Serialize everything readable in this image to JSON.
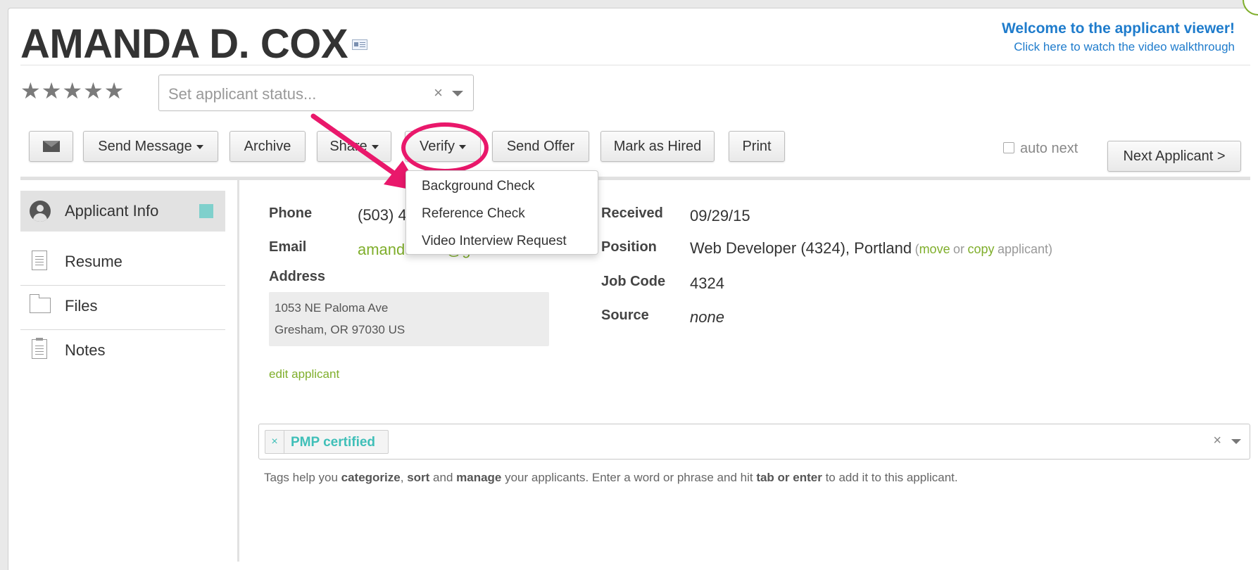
{
  "applicant": {
    "name": "AMANDA D. COX",
    "rating_stars": "★★★★★"
  },
  "welcome": {
    "title": "Welcome to the applicant viewer!",
    "link": "Click here to watch the video walkthrough"
  },
  "status": {
    "placeholder": "Set applicant status...",
    "clear": "×"
  },
  "toolbar": {
    "send_message": "Send Message",
    "archive": "Archive",
    "share": "Share",
    "verify": "Verify",
    "send_offer": "Send Offer",
    "mark_hired": "Mark as Hired",
    "print": "Print",
    "auto_next": "auto next",
    "next_applicant": "Next Applicant >"
  },
  "verify_menu": {
    "items": [
      "Background Check",
      "Reference Check",
      "Video Interview Request"
    ]
  },
  "sidebar": {
    "items": [
      {
        "label": "Applicant Info"
      },
      {
        "label": "Resume"
      },
      {
        "label": "Files"
      },
      {
        "label": "Notes"
      }
    ]
  },
  "contact": {
    "phone_label": "Phone",
    "phone_value": "(503) 4",
    "email_label": "Email",
    "email_value": "amandadcox@gmail.com",
    "address_label": "Address",
    "address_line1": "1053 NE Paloma Ave",
    "address_line2": "Gresham, OR 97030 US",
    "edit_link": "edit applicant"
  },
  "details": {
    "received_label": "Received",
    "received_value": "09/29/15",
    "position_label": "Position",
    "position_value": "Web Developer (4324), Portland",
    "move_link": "move",
    "or_text": "or",
    "copy_link": "copy",
    "applicant_text": "applicant)",
    "paren_open": "(",
    "jobcode_label": "Job Code",
    "jobcode_value": "4324",
    "source_label": "Source",
    "source_value": "none"
  },
  "tags": {
    "items": [
      "PMP certified"
    ],
    "remove": "×",
    "clear": "×",
    "help_1": "Tags help you ",
    "help_b1": "categorize",
    "help_2": ", ",
    "help_b2": "sort",
    "help_3": " and ",
    "help_b3": "manage",
    "help_4": " your applicants. Enter a word or phrase and hit ",
    "help_b4": "tab or enter",
    "help_5": " to add it to this applicant."
  },
  "colors": {
    "accent_blue": "#1f7ccc",
    "link_green": "#7fae2b",
    "tag_teal": "#3fbfb8",
    "annotation_pink": "#e9186b"
  }
}
